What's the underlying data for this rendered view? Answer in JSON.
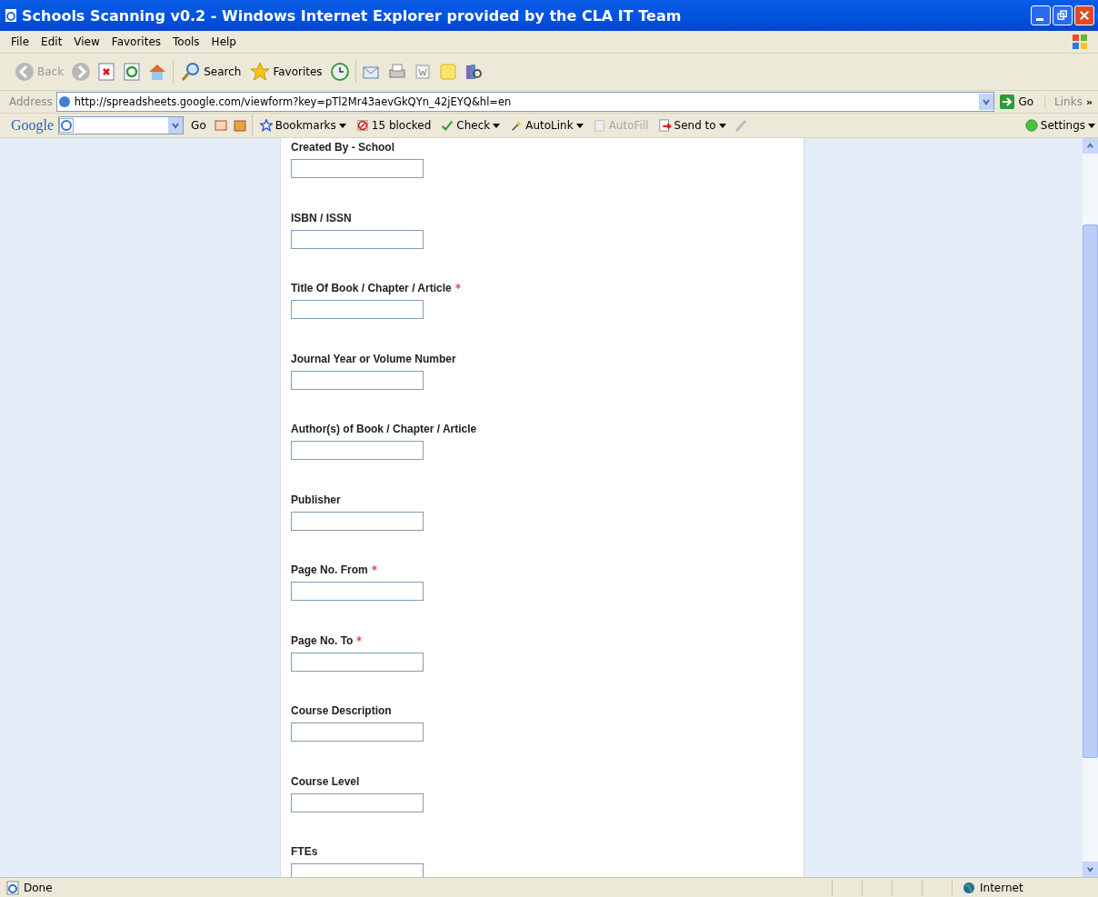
{
  "window": {
    "title": "Schools Scanning v0.2 - Windows Internet Explorer provided by the CLA IT Team"
  },
  "menu": [
    "File",
    "Edit",
    "View",
    "Favorites",
    "Tools",
    "Help"
  ],
  "toolbar": {
    "back": {
      "label": "Back",
      "disabled": true
    },
    "search": "Search",
    "favorites": "Favorites"
  },
  "address": {
    "label": "Address",
    "url": "http://spreadsheets.google.com/viewform?key=pTl2Mr43aevGkQYn_42jEYQ&hl=en",
    "go": "Go",
    "links": "Links",
    "more": "»"
  },
  "google_bar": {
    "logo": "Google",
    "go": "Go",
    "items": [
      {
        "label": "Bookmarks",
        "kind": "bookmark",
        "dropdown": true,
        "disabled": false
      },
      {
        "label": "15 blocked",
        "kind": "blocked",
        "dropdown": false,
        "disabled": false
      },
      {
        "label": "Check",
        "kind": "check",
        "dropdown": true,
        "disabled": false
      },
      {
        "label": "AutoLink",
        "kind": "autolink",
        "dropdown": true,
        "disabled": false
      },
      {
        "label": "AutoFill",
        "kind": "autofill",
        "dropdown": false,
        "disabled": true
      },
      {
        "label": "Send to",
        "kind": "send",
        "dropdown": true,
        "disabled": false
      }
    ],
    "settings": "Settings"
  },
  "form": {
    "fields": [
      {
        "label": "Created By - School",
        "required": false
      },
      {
        "label": "ISBN / ISSN",
        "required": false
      },
      {
        "label": "Title Of Book / Chapter / Article",
        "required": true
      },
      {
        "label": "Journal Year or Volume Number",
        "required": false
      },
      {
        "label": "Author(s) of Book / Chapter / Article",
        "required": false
      },
      {
        "label": "Publisher",
        "required": false
      },
      {
        "label": "Page No. From",
        "required": true
      },
      {
        "label": "Page No. To",
        "required": true
      },
      {
        "label": "Course Description",
        "required": false
      },
      {
        "label": "Course Level",
        "required": false
      },
      {
        "label": "FTEs",
        "required": false
      }
    ]
  },
  "status_bar": {
    "text": "Done",
    "zone": "Internet"
  }
}
